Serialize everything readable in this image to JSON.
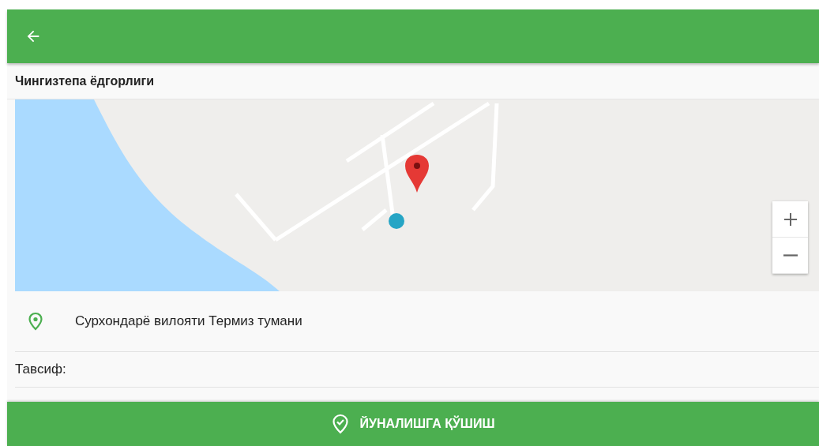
{
  "title": "Чингизтепа ёдгорлиги",
  "address": "Сурхондарё вилояти Термиз тумани",
  "description_label": "Тавсиф:",
  "action_button": "ЙУНАЛИШГА ҚЎШИШ"
}
